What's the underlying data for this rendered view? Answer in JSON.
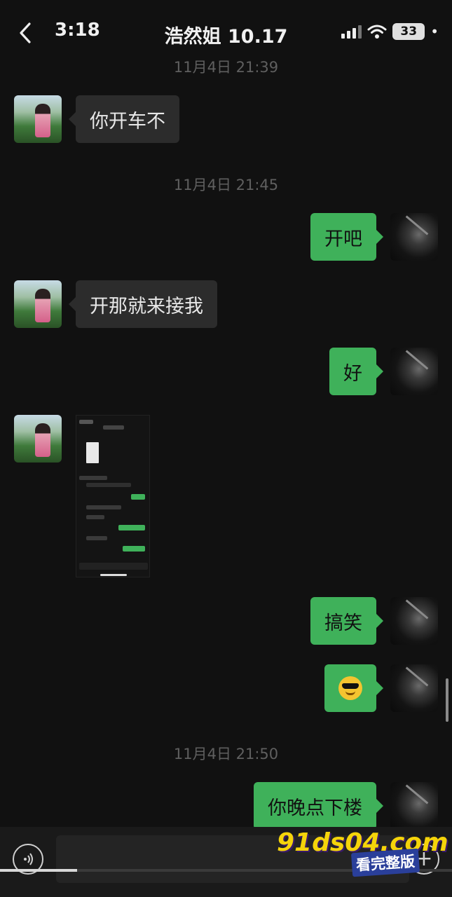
{
  "status_bar": {
    "time": "3:18",
    "battery": "33",
    "more": "•"
  },
  "header": {
    "title": "浩然姐 10.17",
    "back_icon": "chevron-left-icon"
  },
  "messages": [
    {
      "type": "timestamp",
      "text": "11月4日 21:39"
    },
    {
      "type": "incoming",
      "text": "你开车不"
    },
    {
      "type": "timestamp",
      "text": "11月4日 21:45"
    },
    {
      "type": "outgoing",
      "text": "开吧"
    },
    {
      "type": "incoming",
      "text": "开那就来接我"
    },
    {
      "type": "outgoing",
      "text": "好"
    },
    {
      "type": "incoming-image"
    },
    {
      "type": "outgoing",
      "text": "搞笑"
    },
    {
      "type": "outgoing",
      "emoji": "sunglasses-emoji"
    },
    {
      "type": "timestamp",
      "text": "11月4日 21:50"
    },
    {
      "type": "outgoing",
      "text": "你晚点下楼"
    }
  ],
  "bottom_bar": {
    "voice_icon": "voice-icon",
    "plus_icon": "plus-icon",
    "progress": 0.17
  },
  "watermark": {
    "site": "91ds04.com",
    "tag": "看完整版"
  },
  "colors": {
    "background": "#111111",
    "outgoing_bubble": "#3fb15a",
    "incoming_bubble": "#2c2c2c",
    "timestamp": "#5f5f5f"
  }
}
